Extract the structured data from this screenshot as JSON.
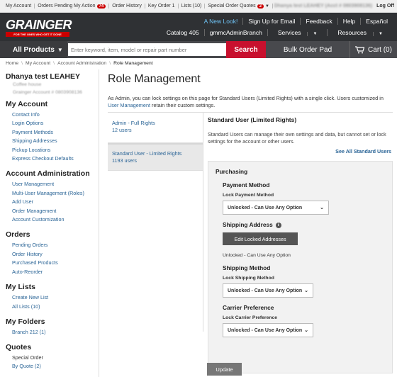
{
  "utility_bar": {
    "my_account": "My Account",
    "orders_pending": "Orders Pending My Action",
    "orders_pending_count": "74",
    "order_history": "Order History",
    "key_order": "Key Order 1",
    "lists": "Lists (10)",
    "special_quotes": "Special Order Quotes",
    "special_quotes_count": "2",
    "account_name": "Dhanya test LEAHEY (Acct # 0803908136)",
    "log_off": "Log Off"
  },
  "brand": {
    "logo": "GRAINGER",
    "tagline": "FOR THE ONES WHO GET IT DONE",
    "links_row1": [
      "A New Look!",
      "Sign Up for Email",
      "Feedback",
      "Help",
      "Español"
    ],
    "links_row2": [
      "Catalog 405",
      "gmmcAdminBranch",
      "Services",
      "Resources"
    ]
  },
  "search": {
    "all_products": "All Products",
    "placeholder": "Enter keyword, item, model or repair part number",
    "button": "Search",
    "bulk_order": "Bulk Order Pad",
    "cart": "Cart (0)"
  },
  "breadcrumb": [
    "Home",
    "My Account",
    "Account Administration",
    "Role Management"
  ],
  "sidebar": {
    "user_name": "Dhanya test LEAHEY",
    "user_sub1": "Coffee house",
    "user_sub2": "Grainger Account # 0803908136",
    "my_account": {
      "title": "My Account",
      "items": [
        "Contact Info",
        "Login Options",
        "Payment Methods",
        "Shipping Addresses",
        "Pickup Locations",
        "Express Checkout Defaults"
      ]
    },
    "account_admin": {
      "title": "Account Administration",
      "items": [
        "User Management",
        "Multi-User Management (Roles)",
        "Add User",
        "Order Management",
        "Account Customization"
      ]
    },
    "orders": {
      "title": "Orders",
      "items": [
        "Pending Orders",
        "Order History",
        "Purchased Products",
        "Auto-Reorder"
      ]
    },
    "my_lists": {
      "title": "My Lists",
      "items": [
        "Create New List",
        "All Lists (10)"
      ]
    },
    "my_folders": {
      "title": "My Folders",
      "items": [
        "Branch 212 (1)"
      ]
    },
    "quotes": {
      "title": "Quotes",
      "sub": "Special Order",
      "items": [
        "By Quote (2)"
      ]
    }
  },
  "main": {
    "title": "Role Management",
    "intro_text": "As Admin, you can lock settings on this page for Standard Users (Limited Rights) with a single click. Users customized in ",
    "intro_link": "User Management",
    "intro_tail": " retain their custom settings.",
    "roles": [
      {
        "name": "Admin - Full Rights",
        "users": "12 users"
      },
      {
        "name": "Standard User - Limited Rights",
        "users": "1193 users"
      }
    ],
    "detail": {
      "title": "Standard User (Limited Rights)",
      "description": "Standard Users can manage their own settings and data, but cannot set or lock settings for the account or other users.",
      "see_all": "See All Standard Users",
      "section": "Purchasing",
      "payment": {
        "title": "Payment Method",
        "label": "Lock Payment Method",
        "value": "Unlocked - Can Use Any Option"
      },
      "shipping_address": {
        "title": "Shipping Address",
        "button": "Edit Locked Addresses",
        "status": "Unlocked - Can Use Any Option"
      },
      "shipping_method": {
        "title": "Shipping Method",
        "label": "Lock Shipping Method",
        "value": "Unlocked - Can Use Any Option"
      },
      "carrier": {
        "title": "Carrier Preference",
        "label": "Lock Carrier Preference",
        "value": "Unlocked - Can Use Any Option"
      }
    },
    "update_button": "Update"
  },
  "colors": {
    "brand_red": "#c8102e",
    "header_dark": "#2f3134",
    "link_blue": "#2a6496"
  }
}
